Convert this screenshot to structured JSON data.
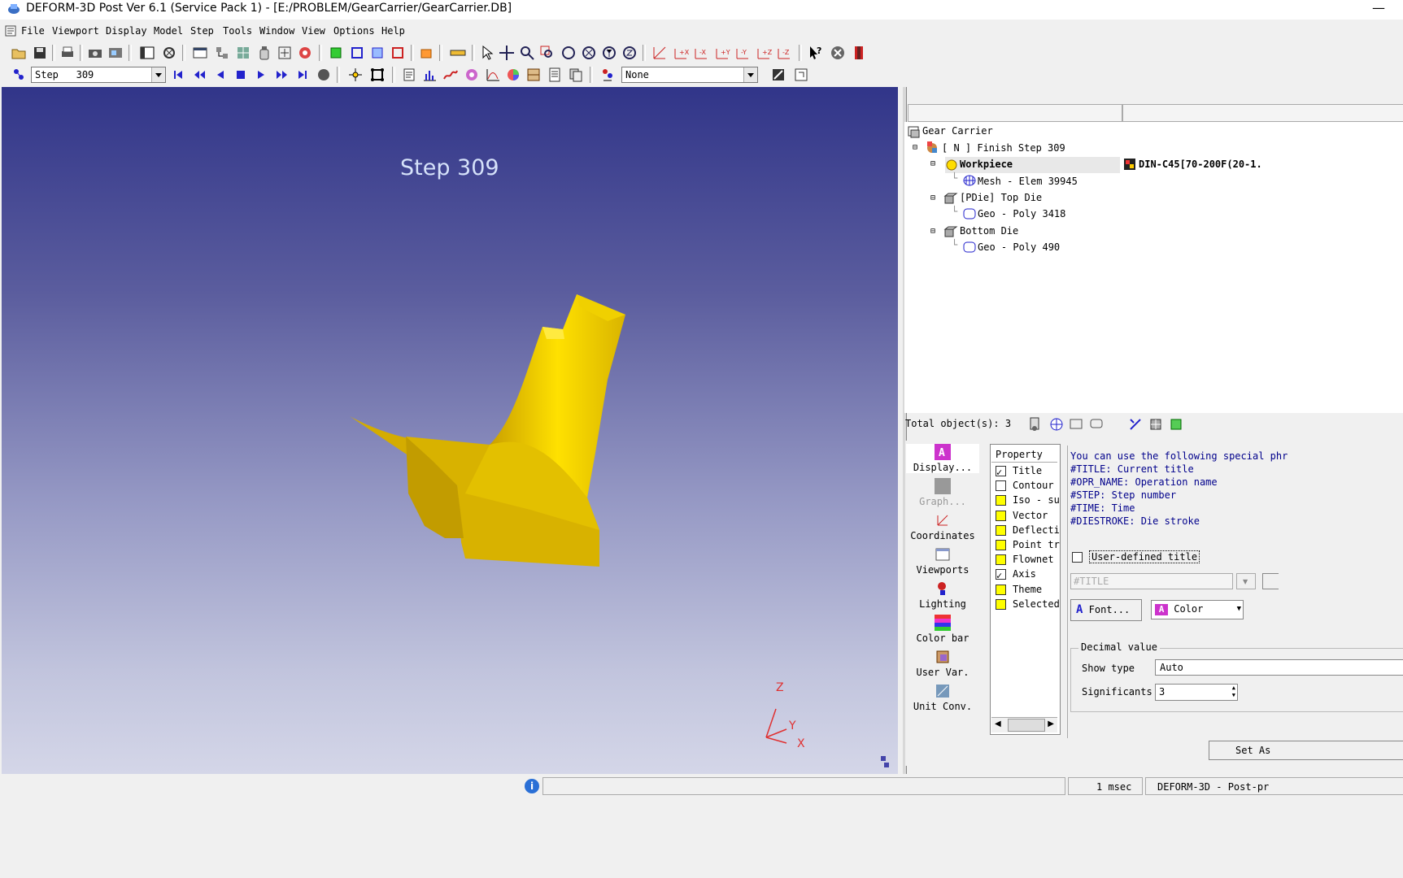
{
  "window": {
    "title": "DEFORM-3D Post Ver 6.1 (Service Pack 1)   - [E:/PROBLEM/GearCarrier/GearCarrier.DB]",
    "min": "—"
  },
  "menu": [
    "File",
    "Viewport",
    "Display",
    "Model",
    "Step",
    "Tools",
    "Window",
    "View",
    "Options",
    "Help"
  ],
  "step_combo": {
    "label": "Step",
    "value": "309"
  },
  "var_combo": {
    "value": "None"
  },
  "viewport": {
    "step_title": "Step  309",
    "axis": {
      "z": "Z",
      "y": "Y",
      "x": "X"
    },
    "part_color": "#f5d000"
  },
  "tree": {
    "root": "Gear Carrier",
    "step": "[ N ]  Finish  Step 309",
    "workpiece": "Workpiece",
    "workpiece_material": "DIN-C45[70-200F(20-1.",
    "mesh": "Mesh - Elem 39945",
    "top_die": "[PDie] Top Die",
    "top_geo": "Geo - Poly 3418",
    "bottom_die": "Bottom Die",
    "bottom_geo": "Geo - Poly 490"
  },
  "total_objects": "Total object(s): 3",
  "categories": [
    "Display...",
    "Graph...",
    "Coordinates",
    "Viewports",
    "Lighting",
    "Color bar",
    "User Var.",
    "Unit Conv."
  ],
  "property": {
    "header": "Property",
    "items": [
      {
        "label": "Title",
        "checked": true,
        "yellow": false
      },
      {
        "label": "Contour",
        "checked": false,
        "yellow": false
      },
      {
        "label": "Iso - su",
        "checked": false,
        "yellow": true
      },
      {
        "label": "Vector",
        "checked": false,
        "yellow": true
      },
      {
        "label": "Deflecti",
        "checked": false,
        "yellow": true
      },
      {
        "label": "Point tr",
        "checked": false,
        "yellow": true
      },
      {
        "label": "Flownet",
        "checked": false,
        "yellow": true
      },
      {
        "label": "Axis",
        "checked": true,
        "yellow": false
      },
      {
        "label": "Theme",
        "checked": false,
        "yellow": true
      },
      {
        "label": "Selected",
        "checked": false,
        "yellow": true
      }
    ]
  },
  "help": {
    "lines": [
      "You can use the following special phr",
      "#TITLE: Current title",
      "#OPR_NAME: Operation name",
      "#STEP: Step number",
      "#TIME: Time",
      "#DIESTROKE: Die stroke"
    ]
  },
  "title_opts": {
    "user_defined": "User-defined title",
    "title_field": "#TITLE",
    "font_btn": "Font...",
    "color_btn": "Color",
    "decimal_group": "Decimal value",
    "show_type_label": "Show type",
    "show_type_value": "Auto",
    "significants_label": "Significants",
    "significants_value": "3",
    "set_as": "Set As"
  },
  "statusbar": {
    "time": "1 msec",
    "app": "DEFORM-3D  -  Post-pr"
  }
}
